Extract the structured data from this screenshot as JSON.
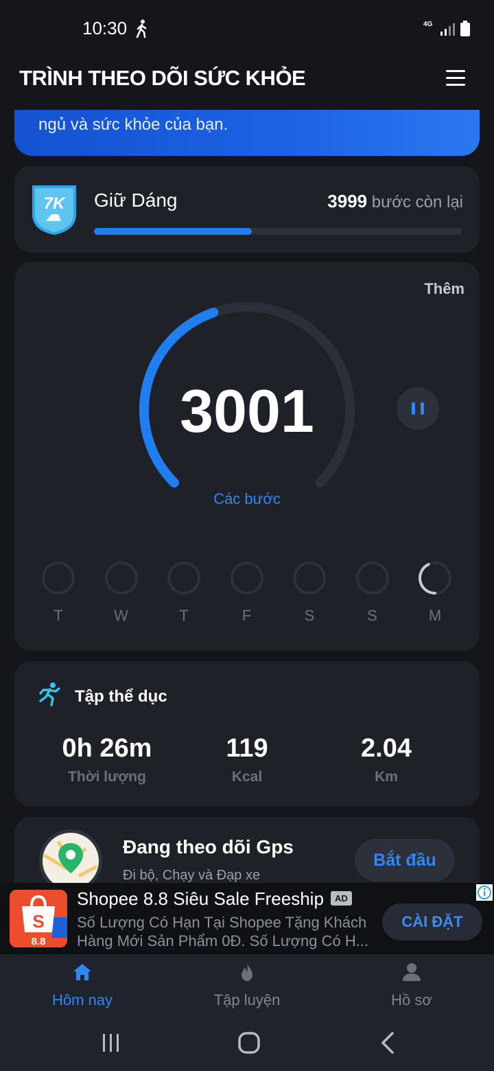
{
  "status_bar": {
    "time": "10:30",
    "network": "4G"
  },
  "header": {
    "title": "TRÌNH THEO DÕI SỨC KHỎE"
  },
  "banner": {
    "text": "ngủ và sức khỏe của bạn."
  },
  "goal": {
    "badge_text": "7K",
    "title": "Giữ Dáng",
    "remaining_value": "3999",
    "remaining_label": "bước còn lại",
    "progress_fraction": 0.43
  },
  "steps": {
    "more_label": "Thêm",
    "count": "3001",
    "label": "Các bước",
    "ring_progress_fraction": 0.43,
    "days": [
      {
        "label": "T",
        "progress": 0
      },
      {
        "label": "W",
        "progress": 0
      },
      {
        "label": "T",
        "progress": 0
      },
      {
        "label": "F",
        "progress": 0
      },
      {
        "label": "S",
        "progress": 0
      },
      {
        "label": "S",
        "progress": 0
      },
      {
        "label": "M",
        "progress": 0.43
      }
    ]
  },
  "exercise": {
    "title": "Tập thể dục",
    "stats": [
      {
        "value": "0h 26m",
        "label": "Thời lượng"
      },
      {
        "value": "119",
        "label": "Kcal"
      },
      {
        "value": "2.04",
        "label": "Km"
      }
    ]
  },
  "gps": {
    "title": "Đang theo dõi Gps",
    "subtitle": "Đi bộ, Chạy và Đạp xe",
    "start_label": "Bắt đầu"
  },
  "ad": {
    "title": "Shopee 8.8 Siêu Sale Freeship",
    "tag": "AD",
    "description": "Số Lượng Có Hạn Tại Shopee Tặng Khách Hàng Mới Sản Phẩm 0Đ. Số Lượng Có H...",
    "install_label": "CÀI ĐẶT",
    "logo_text": "8.8",
    "logo_letter": "S"
  },
  "bottom_nav": {
    "items": [
      {
        "label": "Hôm nay",
        "icon": "home-icon",
        "active": true
      },
      {
        "label": "Tập luyện",
        "icon": "flame-icon",
        "active": false
      },
      {
        "label": "Hồ sơ",
        "icon": "profile-icon",
        "active": false
      }
    ]
  },
  "colors": {
    "accent": "#2f86f5",
    "background": "#14161b",
    "card": "#1e2128",
    "track": "#2c313b"
  }
}
